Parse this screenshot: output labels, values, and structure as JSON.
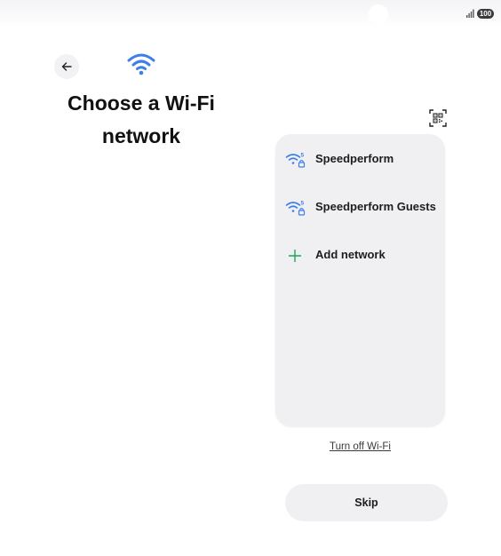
{
  "status_bar": {
    "battery_level": "100",
    "signal_icon": "signal-bars-icon"
  },
  "header": {
    "back_icon": "arrow-left-icon",
    "wifi_icon": "wifi-icon",
    "title": "Choose a Wi-Fi network",
    "qr_icon": "qr-code-scan-icon"
  },
  "networks": {
    "items": [
      {
        "label": "Speedperform",
        "icon": "wifi-5ghz-locked-icon"
      },
      {
        "label": "Speedperform Guests",
        "icon": "wifi-5ghz-locked-icon"
      },
      {
        "label": "Add network",
        "icon": "plus-icon"
      }
    ]
  },
  "actions": {
    "turn_off_wifi": "Turn off Wi-Fi",
    "skip": "Skip"
  },
  "colors": {
    "accent_blue": "#3d7ee8",
    "add_green": "#1ea65a",
    "panel_bg": "#f0f0f2"
  }
}
